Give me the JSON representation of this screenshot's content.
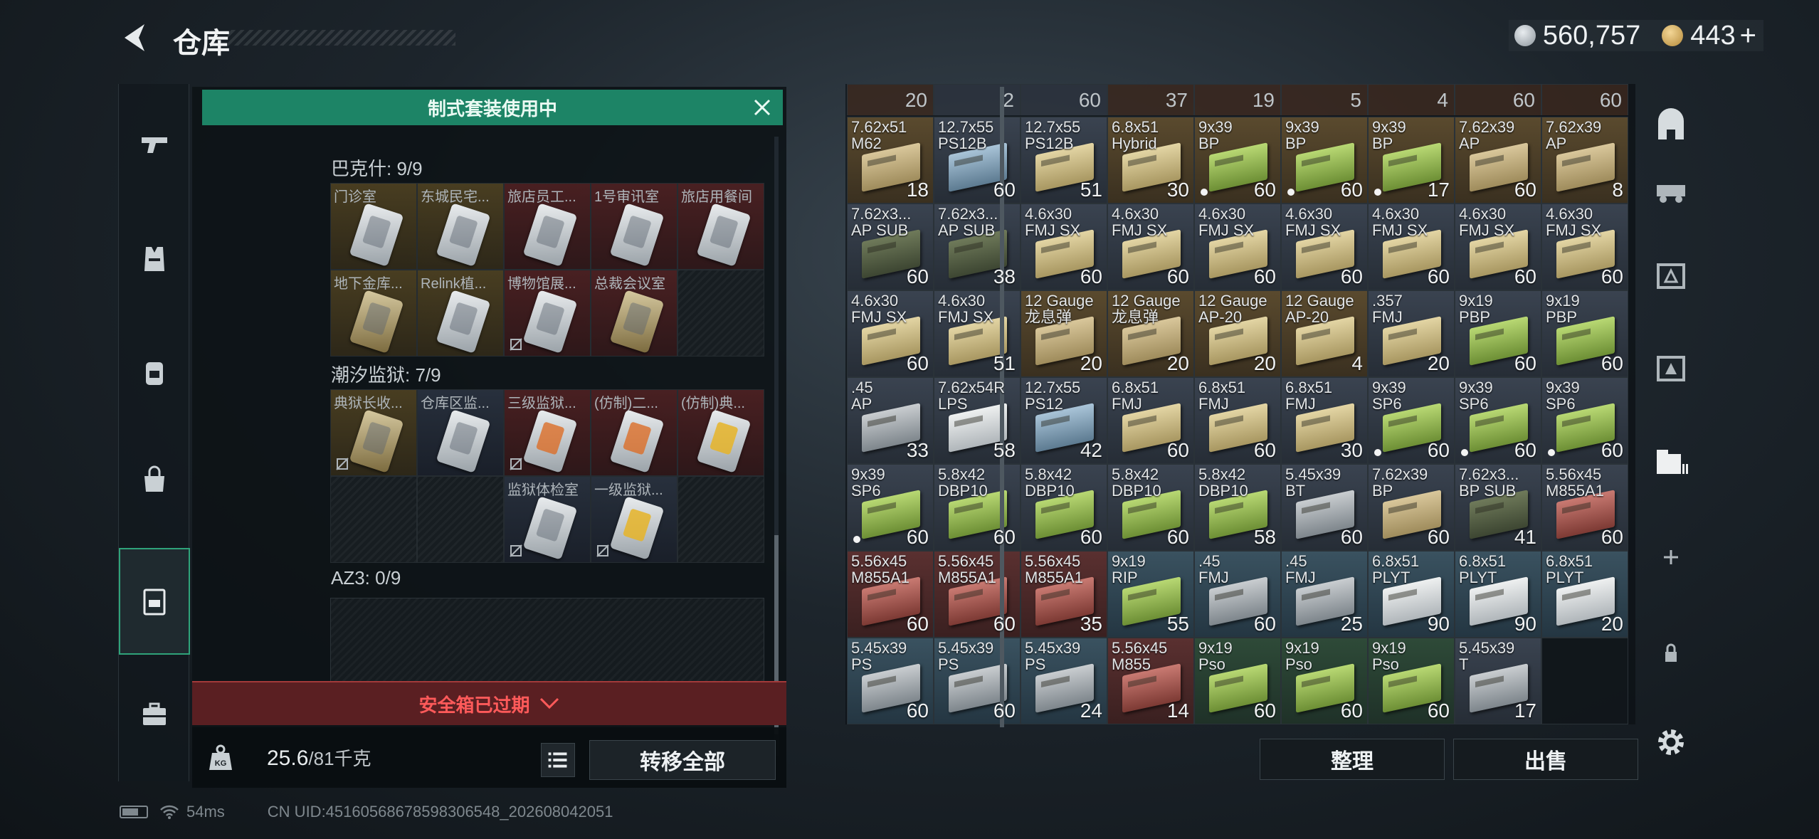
{
  "header": {
    "title": "仓库",
    "silver_amount": "560,757",
    "gold_amount": "443",
    "plus_label": "+"
  },
  "left_nav": [
    "pistol-icon",
    "vest-icon",
    "backpack-icon",
    "bag-icon",
    "safebox-icon",
    "briefcase-icon"
  ],
  "safe_box": {
    "kit_banner": "制式套装使用中",
    "groups": [
      {
        "label": "巴克什: 9/9",
        "slots": [
          {
            "name": "门诊室",
            "tone": "gold",
            "card": "grey",
            "blocked": false
          },
          {
            "name": "东城民宅...",
            "tone": "gold",
            "card": "grey",
            "blocked": false
          },
          {
            "name": "旅店员工...",
            "tone": "red",
            "card": "grey",
            "blocked": false
          },
          {
            "name": "1号审讯室",
            "tone": "red",
            "card": "grey",
            "blocked": false
          },
          {
            "name": "旅店用餐间",
            "tone": "red",
            "card": "grey",
            "blocked": false
          },
          {
            "name": "地下金库...",
            "tone": "gold",
            "card": "dark",
            "blocked": false
          },
          {
            "name": "Relink植...",
            "tone": "gold",
            "card": "grey",
            "blocked": false
          },
          {
            "name": "博物馆展...",
            "tone": "red",
            "card": "grey",
            "blocked": true
          },
          {
            "name": "总裁会议室",
            "tone": "red",
            "card": "dark",
            "blocked": false
          },
          {
            "name": "",
            "tone": "empty",
            "card": "",
            "blocked": false
          }
        ]
      },
      {
        "label": "潮汐监狱: 7/9",
        "slots": [
          {
            "name": "典狱长收...",
            "tone": "gold",
            "card": "dark",
            "blocked": true
          },
          {
            "name": "仓库区监...",
            "tone": "blue",
            "card": "grey",
            "blocked": false
          },
          {
            "name": "三级监狱...",
            "tone": "red",
            "card": "orange",
            "blocked": true
          },
          {
            "name": "(仿制)二...",
            "tone": "red",
            "card": "orange",
            "blocked": false
          },
          {
            "name": "(仿制)典...",
            "tone": "red",
            "card": "yellow",
            "blocked": false
          },
          {
            "name": "",
            "tone": "empty",
            "card": "",
            "blocked": false
          },
          {
            "name": "",
            "tone": "empty",
            "card": "",
            "blocked": false
          },
          {
            "name": "监狱体检室",
            "tone": "blue",
            "card": "grey",
            "blocked": true
          },
          {
            "name": "一级监狱...",
            "tone": "blue",
            "card": "yellow",
            "blocked": true
          },
          {
            "name": "",
            "tone": "empty",
            "card": "",
            "blocked": false
          }
        ]
      },
      {
        "label": "AZ3: 0/9",
        "slots": []
      }
    ],
    "expired_text": "安全箱已过期",
    "weight_current": "25.6",
    "weight_max": "/81千克",
    "transfer_all": "转移全部"
  },
  "warehouse": {
    "top_row_counts": [
      "20",
      "2",
      "60",
      "37",
      "19",
      "5",
      "4",
      "60",
      "60"
    ],
    "items": [
      {
        "name": "7.62x51\nM62",
        "count": "18",
        "tone": "gold",
        "box": "b-tan",
        "dot": false
      },
      {
        "name": "12.7x55\nPS12B",
        "count": "60",
        "tone": "silver",
        "box": "b-blue",
        "dot": false
      },
      {
        "name": "12.7x55\nPS12B",
        "count": "51",
        "tone": "silver",
        "box": "b-sand",
        "dot": false
      },
      {
        "name": "6.8x51\nHybrid",
        "count": "30",
        "tone": "gold",
        "box": "b-sand",
        "dot": false
      },
      {
        "name": "9x39\nBP",
        "count": "60",
        "tone": "gold",
        "box": "b-lime",
        "dot": true
      },
      {
        "name": "9x39\nBP",
        "count": "60",
        "tone": "gold",
        "box": "b-lime",
        "dot": true
      },
      {
        "name": "9x39\nBP",
        "count": "17",
        "tone": "gold",
        "box": "b-lime",
        "dot": true
      },
      {
        "name": "7.62x39\nAP",
        "count": "60",
        "tone": "gold",
        "box": "b-tan",
        "dot": false
      },
      {
        "name": "7.62x39\nAP",
        "count": "8",
        "tone": "gold",
        "box": "b-tan",
        "dot": false
      },
      {
        "name": "7.62x3...\nAP SUB",
        "count": "60",
        "tone": "silver",
        "box": "b-dark",
        "dot": false
      },
      {
        "name": "7.62x3...\nAP SUB",
        "count": "38",
        "tone": "silver",
        "box": "b-dark",
        "dot": false
      },
      {
        "name": "4.6x30\nFMJ SX",
        "count": "60",
        "tone": "silver",
        "box": "b-sand",
        "dot": false
      },
      {
        "name": "4.6x30\nFMJ SX",
        "count": "60",
        "tone": "silver",
        "box": "b-sand",
        "dot": false
      },
      {
        "name": "4.6x30\nFMJ SX",
        "count": "60",
        "tone": "silver",
        "box": "b-sand",
        "dot": false
      },
      {
        "name": "4.6x30\nFMJ SX",
        "count": "60",
        "tone": "silver",
        "box": "b-sand",
        "dot": false
      },
      {
        "name": "4.6x30\nFMJ SX",
        "count": "60",
        "tone": "silver",
        "box": "b-sand",
        "dot": false
      },
      {
        "name": "4.6x30\nFMJ SX",
        "count": "60",
        "tone": "silver",
        "box": "b-sand",
        "dot": false
      },
      {
        "name": "4.6x30\nFMJ SX",
        "count": "60",
        "tone": "silver",
        "box": "b-sand",
        "dot": false
      },
      {
        "name": "4.6x30\nFMJ SX",
        "count": "60",
        "tone": "silver",
        "box": "b-sand",
        "dot": false
      },
      {
        "name": "4.6x30\nFMJ SX",
        "count": "51",
        "tone": "silver",
        "box": "b-sand",
        "dot": false
      },
      {
        "name": "12 Gauge\n龙息弹",
        "count": "20",
        "tone": "gold",
        "box": "b-tan",
        "dot": false
      },
      {
        "name": "12 Gauge\n龙息弹",
        "count": "20",
        "tone": "gold",
        "box": "b-tan",
        "dot": false
      },
      {
        "name": "12 Gauge\nAP-20",
        "count": "20",
        "tone": "gold",
        "box": "b-sand",
        "dot": false
      },
      {
        "name": "12 Gauge\nAP-20",
        "count": "4",
        "tone": "gold",
        "box": "b-sand",
        "dot": false
      },
      {
        "name": ".357\nFMJ",
        "count": "20",
        "tone": "silver",
        "box": "b-sand",
        "dot": false
      },
      {
        "name": "9x19\nPBP",
        "count": "60",
        "tone": "silver",
        "box": "b-lime",
        "dot": false
      },
      {
        "name": "9x19\nPBP",
        "count": "60",
        "tone": "silver",
        "box": "b-lime",
        "dot": false
      },
      {
        "name": ".45\nAP",
        "count": "33",
        "tone": "silver",
        "box": "b-grey",
        "dot": false
      },
      {
        "name": "7.62x54R\nLPS",
        "count": "58",
        "tone": "silver",
        "box": "b-white",
        "dot": false
      },
      {
        "name": "12.7x55\nPS12",
        "count": "42",
        "tone": "silver",
        "box": "b-blue",
        "dot": false
      },
      {
        "name": "6.8x51\nFMJ",
        "count": "60",
        "tone": "silver",
        "box": "b-sand",
        "dot": false
      },
      {
        "name": "6.8x51\nFMJ",
        "count": "60",
        "tone": "silver",
        "box": "b-sand",
        "dot": false
      },
      {
        "name": "6.8x51\nFMJ",
        "count": "30",
        "tone": "silver",
        "box": "b-sand",
        "dot": false
      },
      {
        "name": "9x39\nSP6",
        "count": "60",
        "tone": "silver",
        "box": "b-lime",
        "dot": true
      },
      {
        "name": "9x39\nSP6",
        "count": "60",
        "tone": "silver",
        "box": "b-lime",
        "dot": true
      },
      {
        "name": "9x39\nSP6",
        "count": "60",
        "tone": "silver",
        "box": "b-lime",
        "dot": true
      },
      {
        "name": "9x39\nSP6",
        "count": "60",
        "tone": "silver",
        "box": "b-lime",
        "dot": true
      },
      {
        "name": "5.8x42\nDBP10",
        "count": "60",
        "tone": "silver",
        "box": "b-lime",
        "dot": false
      },
      {
        "name": "5.8x42\nDBP10",
        "count": "60",
        "tone": "silver",
        "box": "b-lime",
        "dot": false
      },
      {
        "name": "5.8x42\nDBP10",
        "count": "60",
        "tone": "silver",
        "box": "b-lime",
        "dot": false
      },
      {
        "name": "5.8x42\nDBP10",
        "count": "58",
        "tone": "silver",
        "box": "b-lime",
        "dot": false
      },
      {
        "name": "5.45x39\nBT",
        "count": "60",
        "tone": "silver",
        "box": "b-grey",
        "dot": false
      },
      {
        "name": "7.62x39\nBP",
        "count": "60",
        "tone": "silver",
        "box": "b-tan",
        "dot": false
      },
      {
        "name": "7.62x3...\nBP SUB",
        "count": "41",
        "tone": "silver",
        "box": "b-dark",
        "dot": false
      },
      {
        "name": "5.56x45\nM855A1",
        "count": "60",
        "tone": "silver",
        "box": "b-red",
        "dot": false
      },
      {
        "name": "5.56x45\nM855A1",
        "count": "60",
        "tone": "red",
        "box": "b-red",
        "dot": false
      },
      {
        "name": "5.56x45\nM855A1",
        "count": "60",
        "tone": "red",
        "box": "b-red",
        "dot": false
      },
      {
        "name": "5.56x45\nM855A1",
        "count": "35",
        "tone": "red",
        "box": "b-red",
        "dot": false
      },
      {
        "name": "9x19\nRIP",
        "count": "55",
        "tone": "steel",
        "box": "b-lime",
        "dot": false
      },
      {
        "name": ".45\nFMJ",
        "count": "60",
        "tone": "steel",
        "box": "b-grey",
        "dot": false
      },
      {
        "name": ".45\nFMJ",
        "count": "25",
        "tone": "steel",
        "box": "b-grey",
        "dot": false
      },
      {
        "name": "6.8x51\nPLYT",
        "count": "90",
        "tone": "steel",
        "box": "b-white",
        "dot": false
      },
      {
        "name": "6.8x51\nPLYT",
        "count": "90",
        "tone": "steel",
        "box": "b-white",
        "dot": false
      },
      {
        "name": "6.8x51\nPLYT",
        "count": "20",
        "tone": "steel",
        "box": "b-white",
        "dot": false
      },
      {
        "name": "5.45x39\nPS",
        "count": "60",
        "tone": "steel",
        "box": "b-grey",
        "dot": false
      },
      {
        "name": "5.45x39\nPS",
        "count": "60",
        "tone": "steel",
        "box": "b-grey",
        "dot": false
      },
      {
        "name": "5.45x39\nPS",
        "count": "24",
        "tone": "steel",
        "box": "b-grey",
        "dot": false
      },
      {
        "name": "5.56x45\nM855",
        "count": "14",
        "tone": "red",
        "box": "b-red",
        "dot": false
      },
      {
        "name": "9x19\nPso",
        "count": "60",
        "tone": "green",
        "box": "b-lime",
        "dot": false
      },
      {
        "name": "9x19\nPso",
        "count": "60",
        "tone": "green",
        "box": "b-lime",
        "dot": false
      },
      {
        "name": "9x19\nPso",
        "count": "60",
        "tone": "green",
        "box": "b-lime",
        "dot": false
      },
      {
        "name": "5.45x39\nT",
        "count": "17",
        "tone": "silver",
        "box": "b-grey",
        "dot": false
      },
      {
        "name": "",
        "count": "",
        "tone": "empty",
        "box": "",
        "dot": false
      }
    ],
    "sort_label": "整理",
    "sell_label": "出售"
  },
  "right_nav": [
    "fortress-icon",
    "vehicle-icon",
    "container-2-icon",
    "container-3-icon",
    "container-4-icon",
    "add-icon",
    "lock-icon",
    "settings-icon"
  ],
  "status": {
    "ping": "54ms",
    "uid": "CN UID:45160568678598306548_202608042051"
  }
}
